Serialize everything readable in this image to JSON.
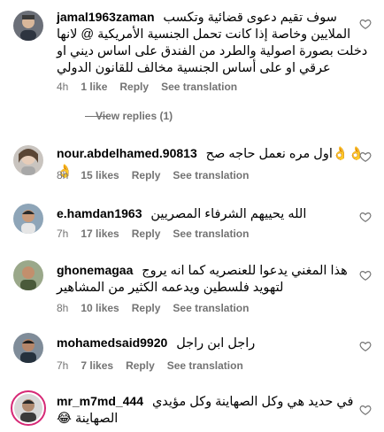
{
  "comments": [
    {
      "username": "jamal1963zaman",
      "text_first": "سوف تقيم دعوى قضائية وتكسب",
      "text_lines": [
        "الملايين وخاصة إذا كانت تحمل الجنسية الأمريكية @ لانها",
        "دخلت بصورة اصولية والطرد من الفندق على اساس ديني او",
        "عرقي او على أساس الجنسية مخالف للقانون الدولي"
      ],
      "time": "4h",
      "likes": "1 like",
      "reply": "Reply",
      "translation": "See translation",
      "view_replies": "View replies (1)"
    },
    {
      "username": "nour.abdelhamed.90813",
      "text_first": "اول مره نعمل حاجه صح👌👌👌",
      "time": "8h",
      "likes": "15 likes",
      "reply": "Reply",
      "translation": "See translation"
    },
    {
      "username": "e.hamdan1963",
      "text_first": "الله يحييهم الشرفاء المصريين",
      "time": "7h",
      "likes": "17 likes",
      "reply": "Reply",
      "translation": "See translation"
    },
    {
      "username": "ghonemagaa",
      "text_first": "هذا المغني يدعوا للعنصريه كما انه يروج",
      "text_lines": [
        "لتهويد فلسطين ويدعمه الكثير من المشاهير"
      ],
      "time": "8h",
      "likes": "10 likes",
      "reply": "Reply",
      "translation": "See translation"
    },
    {
      "username": "mohamedsaid9920",
      "text_first": "راجل ابن راجل",
      "time": "7h",
      "likes": "7 likes",
      "reply": "Reply",
      "translation": "See translation"
    },
    {
      "username": "mr_m7md_444",
      "text_first": "في حديد هي وكل الصهاينة وكل مؤيدي",
      "text_lines": [
        "الصهاينة 😂"
      ]
    }
  ],
  "colors": {
    "secondary": "#737373",
    "ring": "#d62976"
  },
  "icons": {
    "like": "heart-icon"
  }
}
